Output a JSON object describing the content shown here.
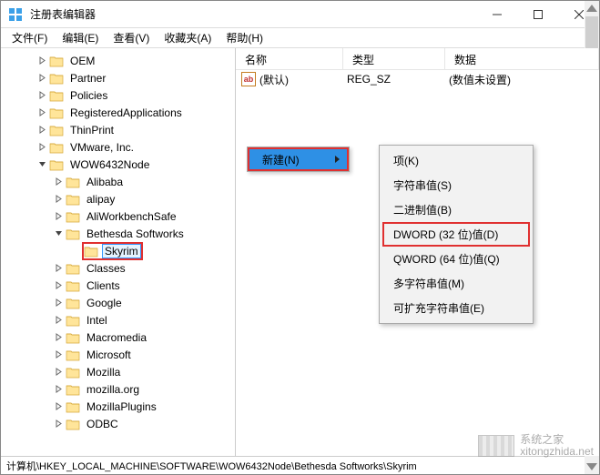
{
  "window": {
    "title": "注册表编辑器"
  },
  "menu": {
    "file": "文件(F)",
    "edit": "编辑(E)",
    "view": "查看(V)",
    "fav": "收藏夹(A)",
    "help": "帮助(H)"
  },
  "tree": {
    "items": [
      {
        "indent": 36,
        "expander": "right",
        "label": "OEM"
      },
      {
        "indent": 36,
        "expander": "right",
        "label": "Partner"
      },
      {
        "indent": 36,
        "expander": "right",
        "label": "Policies"
      },
      {
        "indent": 36,
        "expander": "right",
        "label": "RegisteredApplications"
      },
      {
        "indent": 36,
        "expander": "right",
        "label": "ThinPrint"
      },
      {
        "indent": 36,
        "expander": "right",
        "label": "VMware, Inc."
      },
      {
        "indent": 36,
        "expander": "down",
        "label": "WOW6432Node"
      },
      {
        "indent": 54,
        "expander": "right",
        "label": "Alibaba"
      },
      {
        "indent": 54,
        "expander": "right",
        "label": "alipay"
      },
      {
        "indent": 54,
        "expander": "right",
        "label": "AliWorkbenchSafe"
      },
      {
        "indent": 54,
        "expander": "down",
        "label": "Bethesda Softworks"
      },
      {
        "indent": 72,
        "expander": "none",
        "label": "Skyrim",
        "selected": true,
        "hl": true
      },
      {
        "indent": 54,
        "expander": "right",
        "label": "Classes"
      },
      {
        "indent": 54,
        "expander": "right",
        "label": "Clients"
      },
      {
        "indent": 54,
        "expander": "right",
        "label": "Google"
      },
      {
        "indent": 54,
        "expander": "right",
        "label": "Intel"
      },
      {
        "indent": 54,
        "expander": "right",
        "label": "Macromedia"
      },
      {
        "indent": 54,
        "expander": "right",
        "label": "Microsoft"
      },
      {
        "indent": 54,
        "expander": "right",
        "label": "Mozilla"
      },
      {
        "indent": 54,
        "expander": "right",
        "label": "mozilla.org"
      },
      {
        "indent": 54,
        "expander": "right",
        "label": "MozillaPlugins"
      },
      {
        "indent": 54,
        "expander": "right",
        "label": "ODBC"
      }
    ]
  },
  "list": {
    "headers": {
      "name": "名称",
      "type": "类型",
      "data": "数据"
    },
    "rows": [
      {
        "icon": "ab",
        "name": "(默认)",
        "type": "REG_SZ",
        "data": "(数值未设置)"
      }
    ]
  },
  "context": {
    "new": "新建(N)",
    "submenu": [
      {
        "label": "项(K)"
      },
      {
        "label": "字符串值(S)"
      },
      {
        "label": "二进制值(B)"
      },
      {
        "label": "DWORD (32 位)值(D)",
        "hl": true
      },
      {
        "label": "QWORD (64 位)值(Q)"
      },
      {
        "label": "多字符串值(M)"
      },
      {
        "label": "可扩充字符串值(E)"
      }
    ]
  },
  "statusbar": "计算机\\HKEY_LOCAL_MACHINE\\SOFTWARE\\WOW6432Node\\Bethesda Softworks\\Skyrim",
  "watermark": {
    "line1": "系统之家",
    "line2": "xitongzhida.net"
  }
}
